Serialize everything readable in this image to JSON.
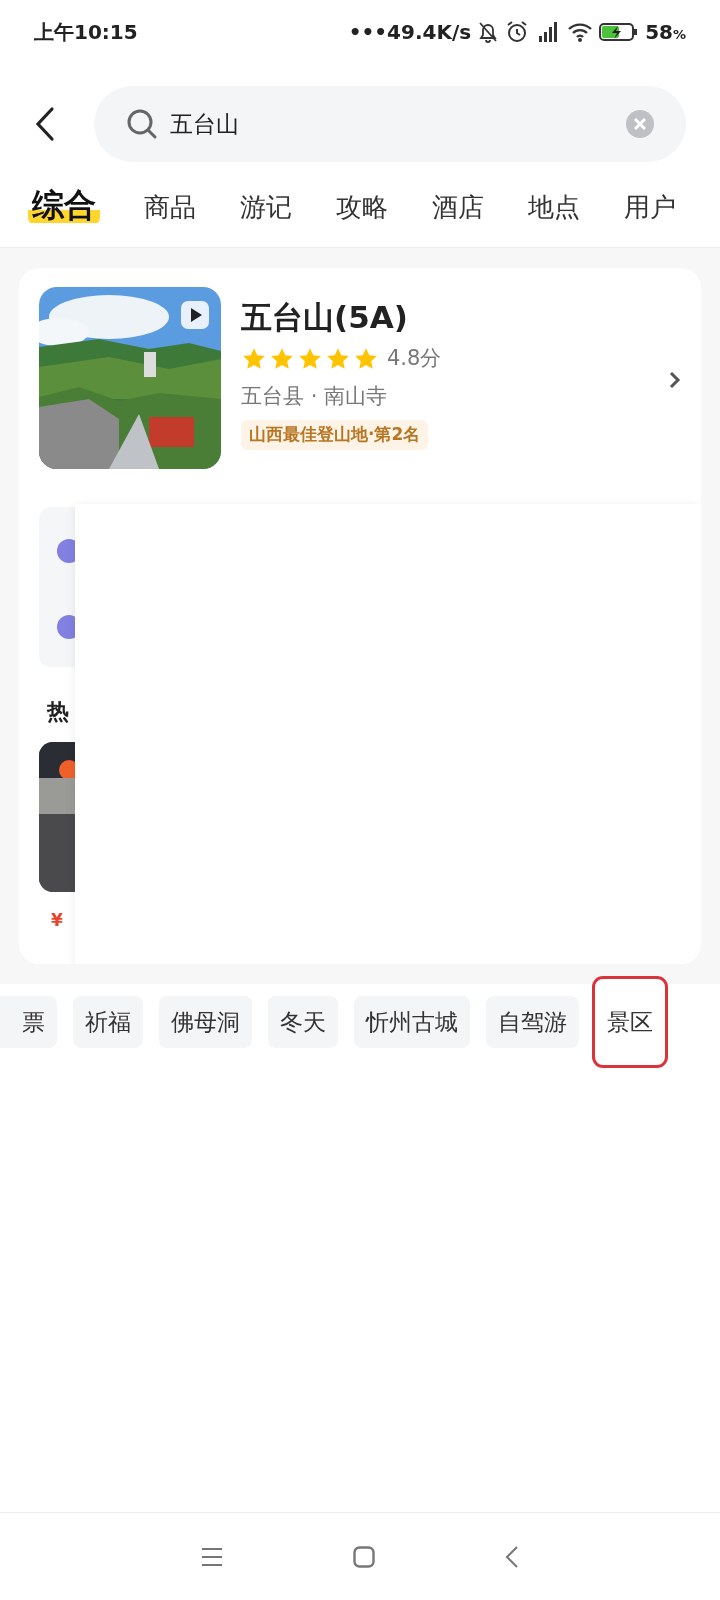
{
  "status_bar": {
    "time": "上午10:15",
    "speed": "•••49.4K/s",
    "battery": "58",
    "battery_unit": "%"
  },
  "search": {
    "value": "五台山"
  },
  "tabs": [
    {
      "label": "综合",
      "selected": true
    },
    {
      "label": "商品",
      "selected": false
    },
    {
      "label": "游记",
      "selected": false
    },
    {
      "label": "攻略",
      "selected": false
    },
    {
      "label": "酒店",
      "selected": false
    },
    {
      "label": "地点",
      "selected": false
    },
    {
      "label": "用户",
      "selected": false
    }
  ],
  "result": {
    "title": "五台山(5A)",
    "stars": 5,
    "score": "4.8分",
    "location": "五台县 · 南山寺",
    "rank_tag": "山西最佳登山地·第2名",
    "section_heading": "热",
    "price_symbol": "¥"
  },
  "tags": [
    {
      "label": "票",
      "highlighted": false
    },
    {
      "label": "祈福",
      "highlighted": false
    },
    {
      "label": "佛母洞",
      "highlighted": false
    },
    {
      "label": "冬天",
      "highlighted": false
    },
    {
      "label": "忻州古城",
      "highlighted": false
    },
    {
      "label": "自驾游",
      "highlighted": false
    },
    {
      "label": "景区",
      "highlighted": true
    }
  ]
}
